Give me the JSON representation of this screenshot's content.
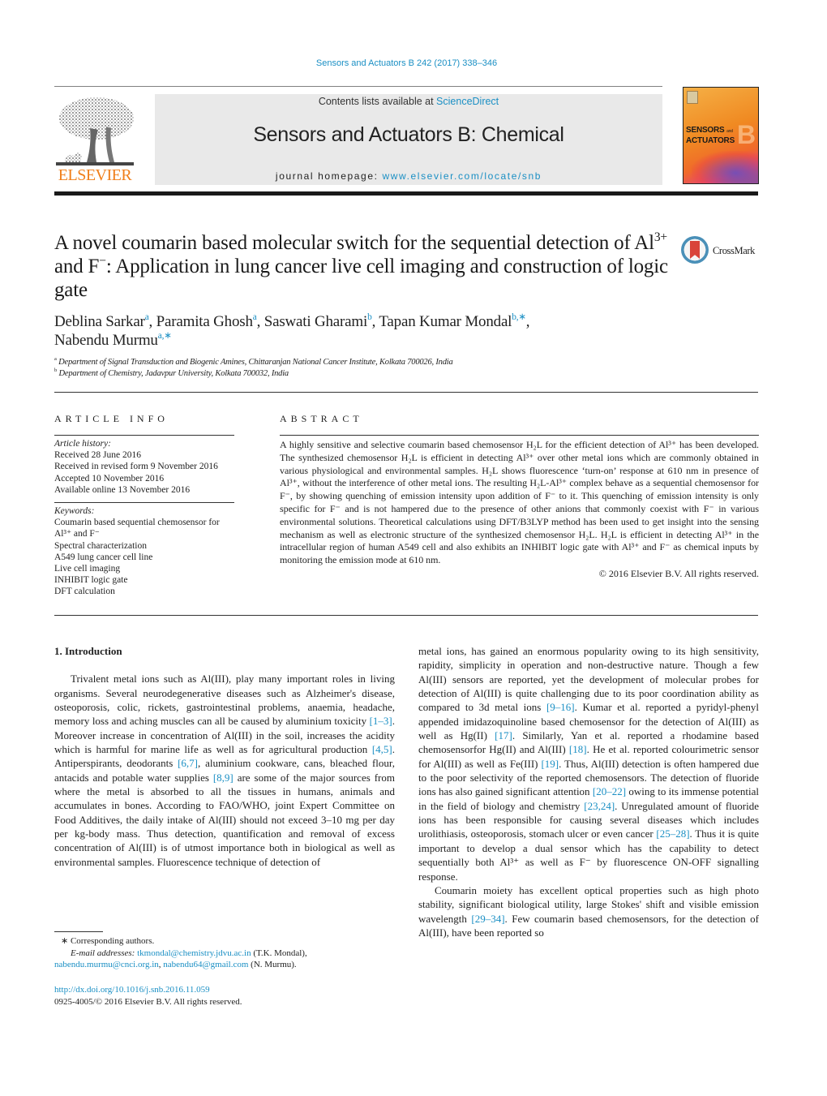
{
  "header": {
    "citation": "Sensors and Actuators B 242 (2017) 338–346",
    "contents_prefix": "Contents lists available at ",
    "contents_link": "ScienceDirect",
    "journal_name": "Sensors and Actuators B: Chemical",
    "homepage_prefix": "journal homepage: ",
    "homepage_link": "www.elsevier.com/locate/snb",
    "publisher_logo_text": "ELSEVIER",
    "cover_title_1": "SENSORS",
    "cover_title_and": "and",
    "cover_title_2": "ACTUATORS",
    "cover_letter": "B"
  },
  "article": {
    "title_part1": "A novel coumarin based molecular switch for the sequential detection of Al",
    "title_sup1": "3+",
    "title_part2": " and F",
    "title_sup2": "−",
    "title_part3": ": Application in lung cancer live cell imaging and construction of logic gate",
    "crossmark_label": "CrossMark",
    "authors": [
      {
        "name": "Deblina Sarkar",
        "marks": "a",
        "sep": ", "
      },
      {
        "name": "Paramita Ghosh",
        "marks": "a",
        "sep": ", "
      },
      {
        "name": "Saswati Gharami",
        "marks": "b",
        "sep": ", "
      },
      {
        "name": "Tapan Kumar Mondal",
        "marks": "b,∗",
        "sep": ","
      },
      {
        "name": "Nabendu Murmu",
        "marks": "a,∗",
        "sep": ""
      }
    ],
    "affiliations": [
      {
        "mark": "a",
        "text": "Department of Signal Transduction and Biogenic Amines, Chittaranjan National Cancer Institute, Kolkata 700026, India"
      },
      {
        "mark": "b",
        "text": "Department of Chemistry, Jadavpur University, Kolkata 700032, India"
      }
    ]
  },
  "article_info": {
    "heading": "ARTICLE INFO",
    "history_label": "Article history:",
    "history": [
      "Received 28 June 2016",
      "Received in revised form 9 November 2016",
      "Accepted 10 November 2016",
      "Available online 13 November 2016"
    ],
    "keywords_label": "Keywords:",
    "keywords": [
      "Coumarin based sequential chemosensor for Al³⁺ and F⁻",
      "Spectral characterization",
      "A549 lung cancer cell line",
      "Live cell imaging",
      "INHIBIT logic gate",
      "DFT calculation"
    ]
  },
  "abstract": {
    "heading": "ABSTRACT",
    "text": "A highly sensitive and selective coumarin based chemosensor H₂L for the efficient detection of Al³⁺ has been developed. The synthesized chemosensor H₂L is efficient in detecting Al³⁺ over other metal ions which are commonly obtained in various physiological and environmental samples. H₂L shows fluorescence ‘turn-on’ response at 610 nm in presence of Al³⁺, without the interference of other metal ions. The resulting H₂L-Al³⁺ complex behave as a sequential chemosensor for F⁻, by showing quenching of emission intensity upon addition of F⁻ to it. This quenching of emission intensity is only specific for F⁻ and is not hampered due to the presence of other anions that commonly coexist with F⁻ in various environmental solutions. Theoretical calculations using DFT/B3LYP method has been used to get insight into the sensing mechanism as well as electronic structure of the synthesized chemosensor H₂L. H₂L is efficient in detecting Al³⁺ in the intracellular region of human A549 cell and also exhibits an INHIBIT logic gate with Al³⁺ and F⁻ as chemical inputs by monitoring the emission mode at 610 nm.",
    "copyright": "© 2016 Elsevier B.V. All rights reserved."
  },
  "body": {
    "section_heading": "1.  Introduction",
    "left_p1": [
      {
        "t": "Trivalent metal ions such as Al(III), play many important roles in living organisms. Several neurodegenerative diseases such as Alzheimer's disease, osteoporosis, colic, rickets, gastrointestinal problems, anaemia, headache, memory loss and aching muscles can all be caused by aluminium toxicity "
      },
      {
        "ref": "[1–3]"
      },
      {
        "t": ". Moreover increase in concentration of Al(III) in the soil, increases the acidity which is harmful for marine life as well as for agricultural production "
      },
      {
        "ref": "[4,5]"
      },
      {
        "t": ". Antiperspirants, deodorants "
      },
      {
        "ref": "[6,7]"
      },
      {
        "t": ", aluminium cookware, cans, bleached flour, antacids and potable water supplies "
      },
      {
        "ref": "[8,9]"
      },
      {
        "t": " are some of the major sources from where the metal is absorbed to all the tissues in humans, animals and accumulates in bones. According to FAO/WHO, joint Expert Committee on Food Additives, the daily intake of Al(III) should not exceed 3–10 mg per day per kg-body mass. Thus detection, quantification and removal of excess concentration of Al(III) is of utmost importance both in biological as well as environmental samples. Fluorescence technique of detection of"
      }
    ],
    "right_p1": [
      {
        "t": "metal ions, has gained an enormous popularity owing to its high sensitivity, rapidity, simplicity in operation and non-destructive nature. Though a few Al(III) sensors are reported, yet the development of molecular probes for detection of Al(III) is quite challenging due to its poor coordination ability as compared to 3d metal ions "
      },
      {
        "ref": "[9–16]"
      },
      {
        "t": ". Kumar et al. reported a pyridyl-phenyl appended imidazoquinoline based chemosensor for the detection of Al(III) as well as Hg(II) "
      },
      {
        "ref": "[17]"
      },
      {
        "t": ". Similarly, Yan et al. reported a rhodamine based chemosensorfor Hg(II) and Al(III) "
      },
      {
        "ref": "[18]"
      },
      {
        "t": ". He et al. reported colourimetric sensor for Al(III) as well as Fe(III) "
      },
      {
        "ref": "[19]"
      },
      {
        "t": ". Thus, Al(III) detection is often hampered due to the poor selectivity of the reported chemosensors. The detection of fluoride ions has also gained significant attention "
      },
      {
        "ref": "[20–22]"
      },
      {
        "t": " owing to its immense potential in the field of biology and chemistry "
      },
      {
        "ref": "[23,24]"
      },
      {
        "t": ". Unregulated amount of fluoride ions has been responsible for causing several diseases which includes urolithiasis, osteoporosis, stomach ulcer or even cancer "
      },
      {
        "ref": "[25–28]"
      },
      {
        "t": ". Thus it is quite important to develop a dual sensor which has the capability to detect sequentially both Al³⁺ as well as F⁻ by fluorescence ON-OFF signalling response."
      }
    ],
    "right_p2": [
      {
        "t": "Coumarin moiety has excellent optical properties such as high photo stability, significant biological utility, large Stokes' shift and visible emission wavelength "
      },
      {
        "ref": "[29–34]"
      },
      {
        "t": ". Few coumarin based chemosensors, for the detection of Al(III), have been reported so"
      }
    ]
  },
  "footnotes": {
    "corresponding": "∗  Corresponding authors.",
    "email_label": "E-mail addresses:",
    "email1": "tkmondal@chemistry.jdvu.ac.in",
    "email1_owner": " (T.K. Mondal),",
    "email2": "nabendu.murmu@cnci.org.in",
    "email_sep": ", ",
    "email3": "nabendu64@gmail.com",
    "email23_owner": " (N. Murmu).",
    "doi": "http://dx.doi.org/10.1016/j.snb.2016.11.059",
    "issn": "0925-4005/© 2016 Elsevier B.V. All rights reserved."
  }
}
